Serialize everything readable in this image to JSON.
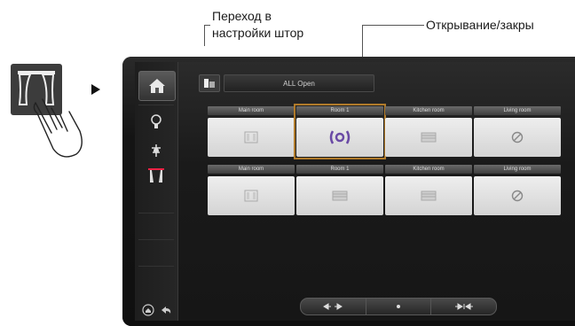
{
  "annotations": {
    "settings_callout": [
      "Переход в",
      "настройки штор"
    ],
    "open_close_callout": "Открывание/закры"
  },
  "topbar": {
    "field_value": "ALL Open"
  },
  "rooms_row1": [
    {
      "label": "Main room",
      "icon": "curtain-icon"
    },
    {
      "label": "Room 1",
      "icon": "curtain-open-close-icon",
      "selected": true
    },
    {
      "label": "Kitchen room",
      "icon": "blind-icon"
    },
    {
      "label": "Living room",
      "icon": "disabled-icon"
    }
  ],
  "rooms_row2": [
    {
      "label": "Main room",
      "icon": "curtain-icon"
    },
    {
      "label": "Room 1",
      "icon": "blind-icon"
    },
    {
      "label": "Kitchen room",
      "icon": "blind-icon"
    },
    {
      "label": "Living room",
      "icon": "disabled-icon"
    }
  ],
  "colors": {
    "accent": "#b07a2a",
    "purple_icon": "#6a4aa5"
  }
}
